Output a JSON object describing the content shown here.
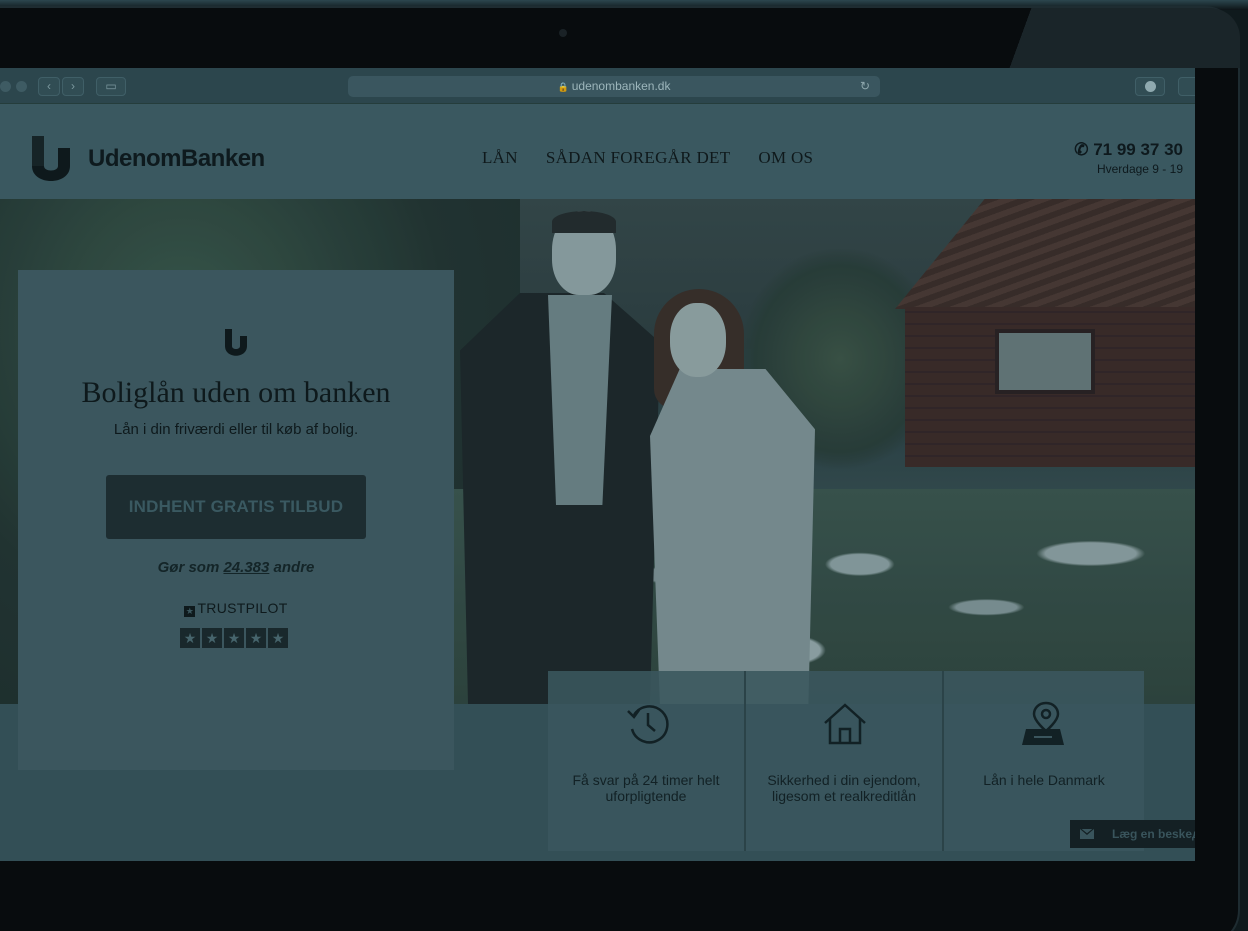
{
  "browser": {
    "url": "udenombanken.dk"
  },
  "header": {
    "logo_text": "UdenomBanken",
    "nav": [
      "LÅN",
      "SÅDAN FOREGÅR DET",
      "OM OS"
    ],
    "phone_number": "71 99 37 30",
    "phone_hours": "Hverdage 9 - 19"
  },
  "hero_card": {
    "title": "Boliglån uden om banken",
    "subtitle": "Lån i din friværdi eller til køb af bolig.",
    "cta_label": "INDHENT GRATIS TILBUD",
    "social_proof_prefix": "Gør som ",
    "social_proof_count": "24.383",
    "social_proof_suffix": " andre",
    "trustpilot_label": "TRUSTPILOT",
    "rating": 5
  },
  "features": [
    {
      "icon": "clock-icon",
      "text": "Få svar på 24 timer helt uforpligtende"
    },
    {
      "icon": "house-icon",
      "text": "Sikkerhed i din ejendom, ligesom et realkreditlån"
    },
    {
      "icon": "map-pin-icon",
      "text": "Lån i hele Danmark"
    }
  ],
  "message_tab": {
    "label": "Læg en beskeд"
  },
  "colors": {
    "overlay_teal": "#3e5e67",
    "dark": "#0f1a1d",
    "cta": "#1f2f34"
  }
}
